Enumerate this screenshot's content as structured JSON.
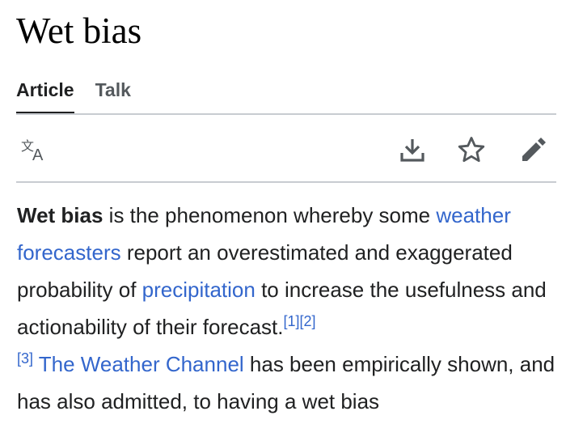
{
  "page": {
    "title": "Wet bias"
  },
  "tabs": [
    {
      "label": "Article",
      "active": true
    },
    {
      "label": "Talk",
      "active": false
    }
  ],
  "toolbar": {
    "icons": [
      "language-icon",
      "download-icon",
      "star-icon",
      "edit-pencil-icon"
    ]
  },
  "article": {
    "bold_term": "Wet bias",
    "text1": " is the phenomenon whereby some ",
    "link1": "weather forecasters",
    "text2": " report an overestimated and exaggerated probability of ",
    "link2": "precipitation",
    "text3": " to increase the usefulness and actionability of their forecast.",
    "cite1": "[1]",
    "cite2": "[2]",
    "cite3": "[3]",
    "text4": " ",
    "link3": "The Weather Channel",
    "text5": " has been empirically shown, and has also admitted, to having a wet bias"
  },
  "colors": {
    "link": "#3366cc",
    "text": "#202122",
    "tab_inactive": "#54595d",
    "rule": "#c8ccd1"
  }
}
